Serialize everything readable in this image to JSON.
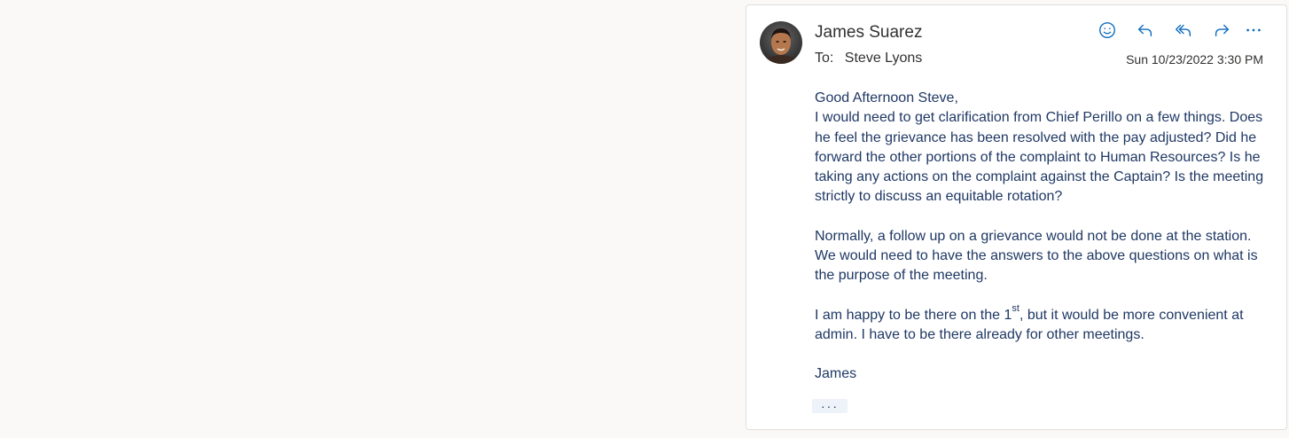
{
  "email": {
    "sender_name": "James Suarez",
    "to_label": "To:",
    "recipient": "Steve Lyons",
    "date": "Sun 10/23/2022 3:30 PM",
    "body": {
      "greeting": "Good Afternoon Steve,",
      "p1": "I would need to get clarification from Chief Perillo on a few things.  Does he feel the grievance has been resolved with the pay adjusted?  Did he forward the other portions of the complaint to Human Resources?  Is he taking any actions on the complaint against the Captain?  Is the meeting strictly to discuss an equitable rotation?",
      "p2": "Normally, a follow up on a grievance would not be done at the station.  We would need to have the answers to the above questions on what is the purpose of the meeting.",
      "p3_before": "I am happy to be there on the 1",
      "p3_sup": "st",
      "p3_after": ", but it would be more convenient at admin.  I have to be there already for other meetings.",
      "signature": "James"
    },
    "more_label": "···"
  },
  "actions": [
    {
      "name": "react-icon"
    },
    {
      "name": "reply-icon"
    },
    {
      "name": "reply-all-icon"
    },
    {
      "name": "forward-icon"
    },
    {
      "name": "more-actions-icon"
    }
  ],
  "colors": {
    "accent": "#0f6cbd",
    "body_text": "#1f3864",
    "header_text": "#323130",
    "background": "#faf9f8"
  }
}
